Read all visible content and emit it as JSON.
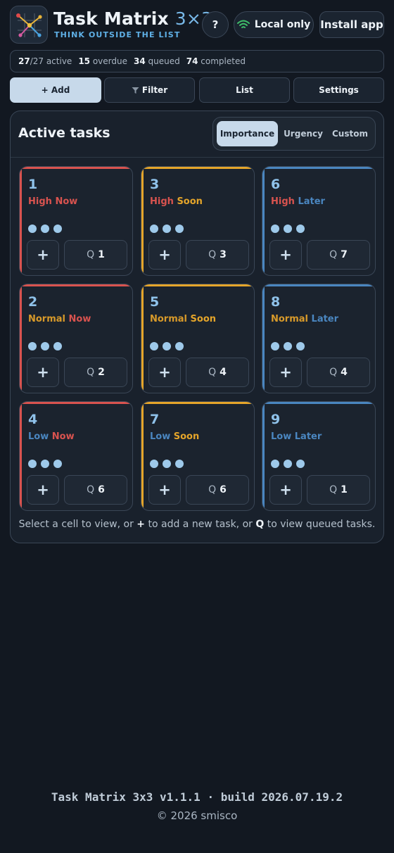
{
  "app": {
    "title_main": "Task Matrix",
    "title_accent": "3×3",
    "subtitle": "THINK OUTSIDE THE LIST",
    "help_label": "?",
    "local_label": "Local only",
    "install_label": "Install app"
  },
  "stats": {
    "active_num": "27",
    "active_rest": "/27 active",
    "overdue_num": "15",
    "overdue_label": "overdue",
    "queued_num": "34",
    "queued_label": "queued",
    "completed_num": "74",
    "completed_label": "completed"
  },
  "toolbar": {
    "add_label": "+ Add",
    "filter_label": "Filter",
    "list_label": "List",
    "settings_label": "Settings"
  },
  "panel": {
    "title": "Active tasks",
    "tabs": {
      "importance": "Importance",
      "urgency": "Urgency",
      "custom": "Custom"
    },
    "selected_tab": "Importance"
  },
  "colors": {
    "now": "#d9534f",
    "soon": "#e5a52a",
    "later": "#4a86c0",
    "high": "#d9534f",
    "normal": "#d89a2a",
    "low": "#4a86c0"
  },
  "cells": [
    {
      "num": "1",
      "level": "High",
      "time": "Now",
      "plus": "+",
      "q_key": "Q",
      "q_count": "1"
    },
    {
      "num": "3",
      "level": "High",
      "time": "Soon",
      "plus": "+",
      "q_key": "Q",
      "q_count": "3"
    },
    {
      "num": "6",
      "level": "High",
      "time": "Later",
      "plus": "+",
      "q_key": "Q",
      "q_count": "7"
    },
    {
      "num": "2",
      "level": "Normal",
      "time": "Now",
      "plus": "+",
      "q_key": "Q",
      "q_count": "2"
    },
    {
      "num": "5",
      "level": "Normal",
      "time": "Soon",
      "plus": "+",
      "q_key": "Q",
      "q_count": "4"
    },
    {
      "num": "8",
      "level": "Normal",
      "time": "Later",
      "plus": "+",
      "q_key": "Q",
      "q_count": "4"
    },
    {
      "num": "4",
      "level": "Low",
      "time": "Now",
      "plus": "+",
      "q_key": "Q",
      "q_count": "6"
    },
    {
      "num": "7",
      "level": "Low",
      "time": "Soon",
      "plus": "+",
      "q_key": "Q",
      "q_count": "6"
    },
    {
      "num": "9",
      "level": "Low",
      "time": "Later",
      "plus": "+",
      "q_key": "Q",
      "q_count": "1"
    }
  ],
  "hint": {
    "part1": "Select a cell to view, or ",
    "plus": "+",
    "part2": " to add a new task, or ",
    "q": "Q",
    "part3": " to view queued tasks."
  },
  "footer": {
    "version": "Task Matrix 3x3 v1.1.1 · build 2026.07.19.2",
    "copyright": "© 2026 smisco"
  }
}
